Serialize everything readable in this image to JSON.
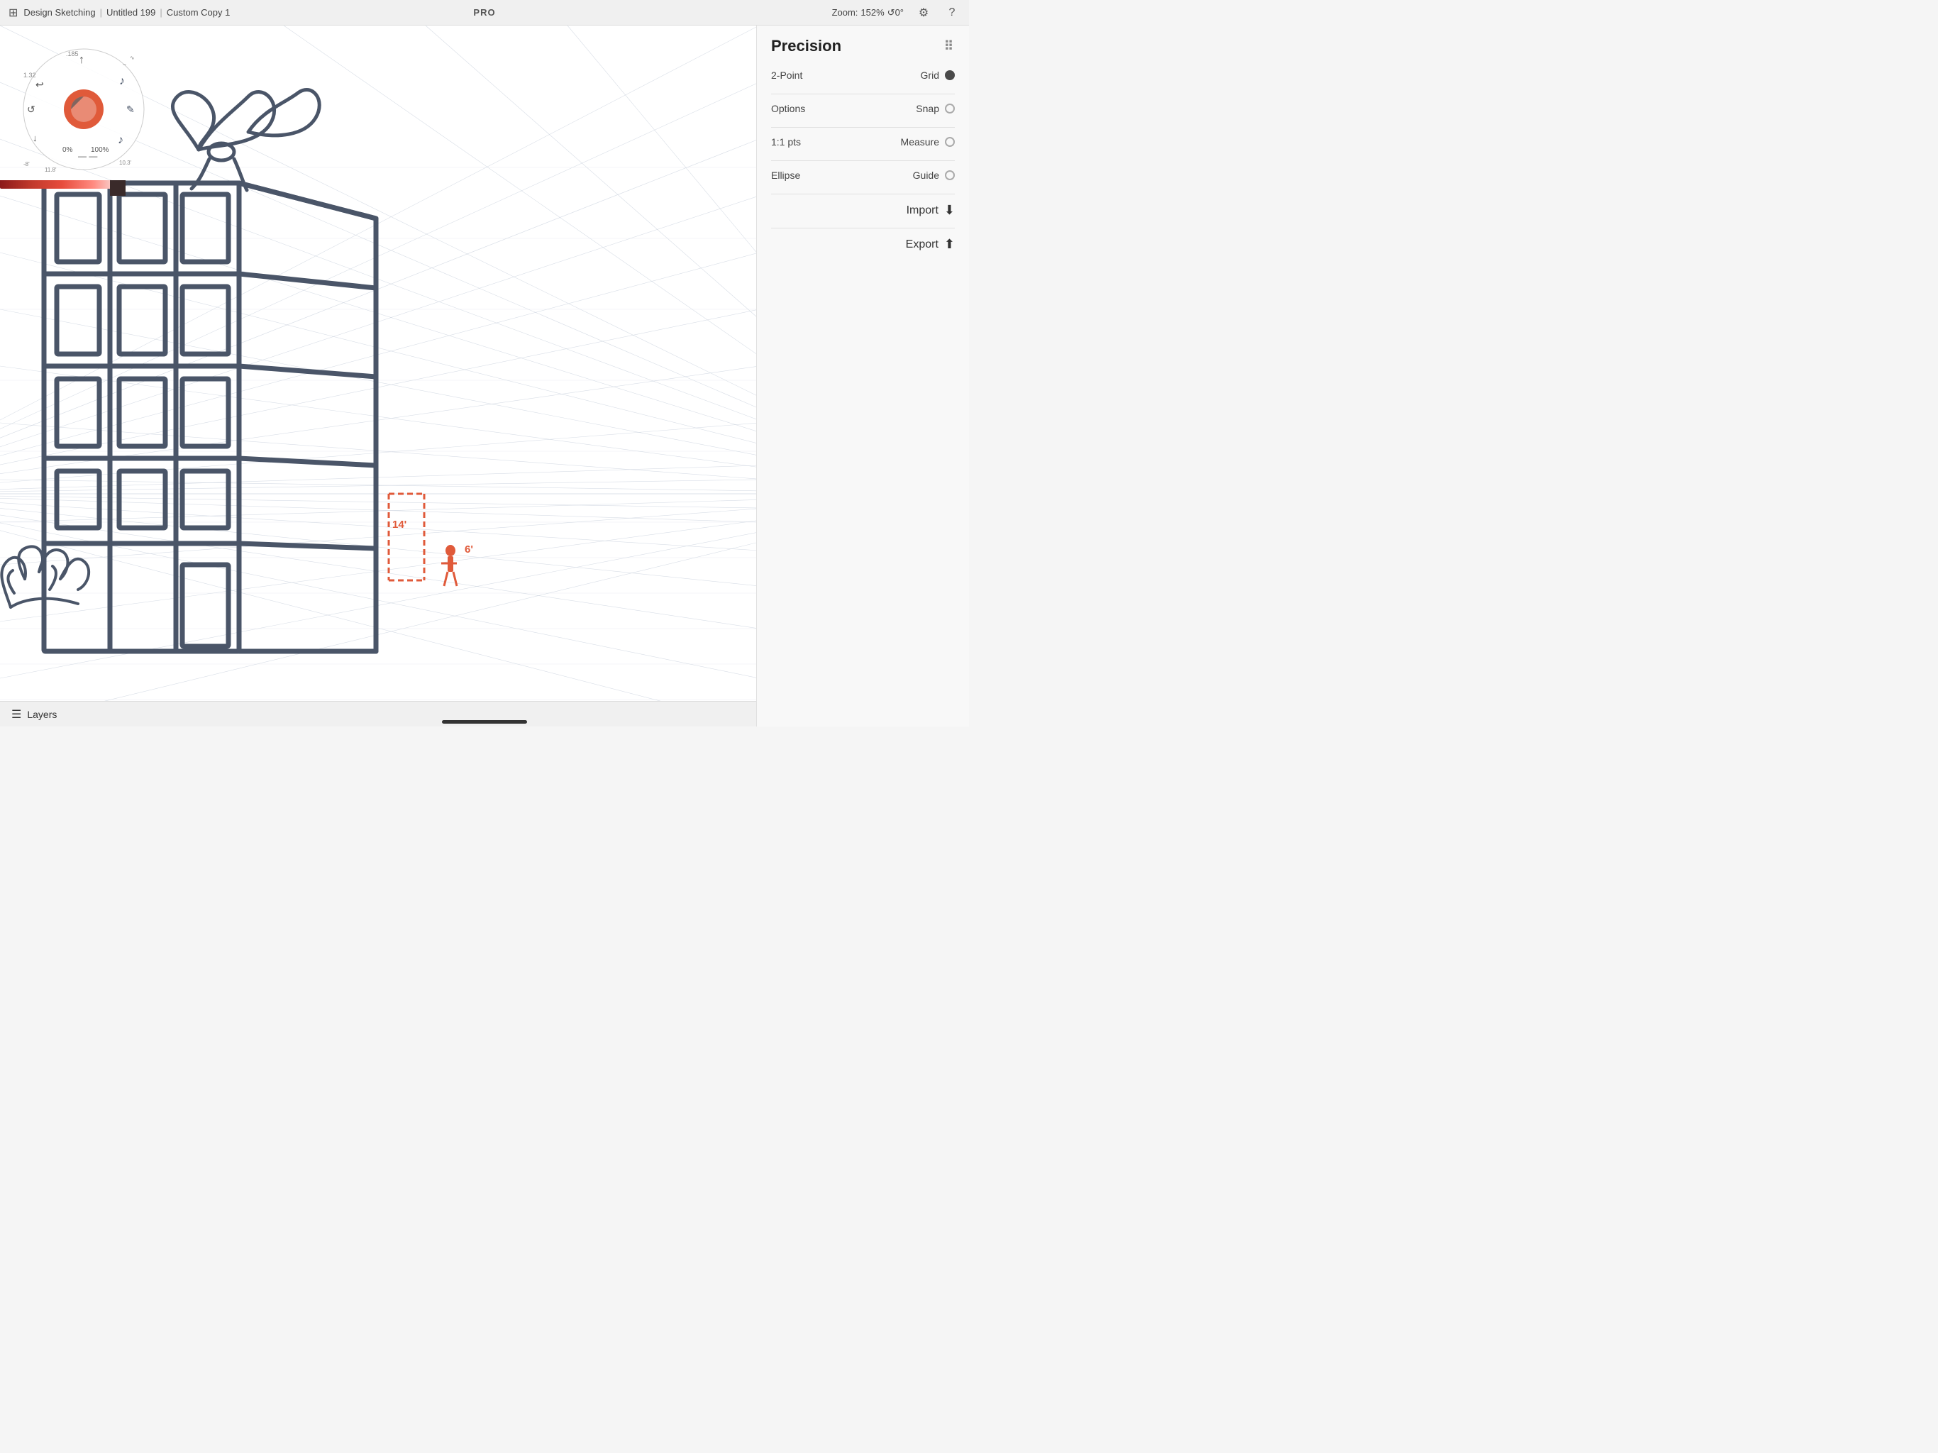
{
  "topbar": {
    "app_name": "Design Sketching",
    "separator1": "|",
    "file_name": "Untitled 199",
    "separator2": "|",
    "copy_name": "Custom Copy 1",
    "pro_label": "PRO",
    "zoom_label": "Zoom:",
    "zoom_value": "152%",
    "angle_value": "↺0°",
    "settings_icon": "⚙",
    "help_icon": "?"
  },
  "right_panel": {
    "title": "Precision",
    "grid_dots": "⠿",
    "row1": {
      "label_left": "2-Point",
      "separator": "·",
      "label_right": "Grid",
      "control": "filled"
    },
    "row2": {
      "label_left": "Options",
      "separator": "·",
      "label_right": "Snap",
      "control": "empty"
    },
    "row3": {
      "label_left": "1:1 pts",
      "separator": "·",
      "label_right": "Measure",
      "control": "empty"
    },
    "row4": {
      "label_left": "Ellipse",
      "separator": "·",
      "label_right": "Guide",
      "control": "empty"
    },
    "import_label": "Import",
    "export_label": "Export"
  },
  "layers": {
    "label": "Layers"
  },
  "measurements": {
    "height": "14'",
    "width": "6'"
  },
  "canvas": {
    "bg": "#ffffff"
  }
}
